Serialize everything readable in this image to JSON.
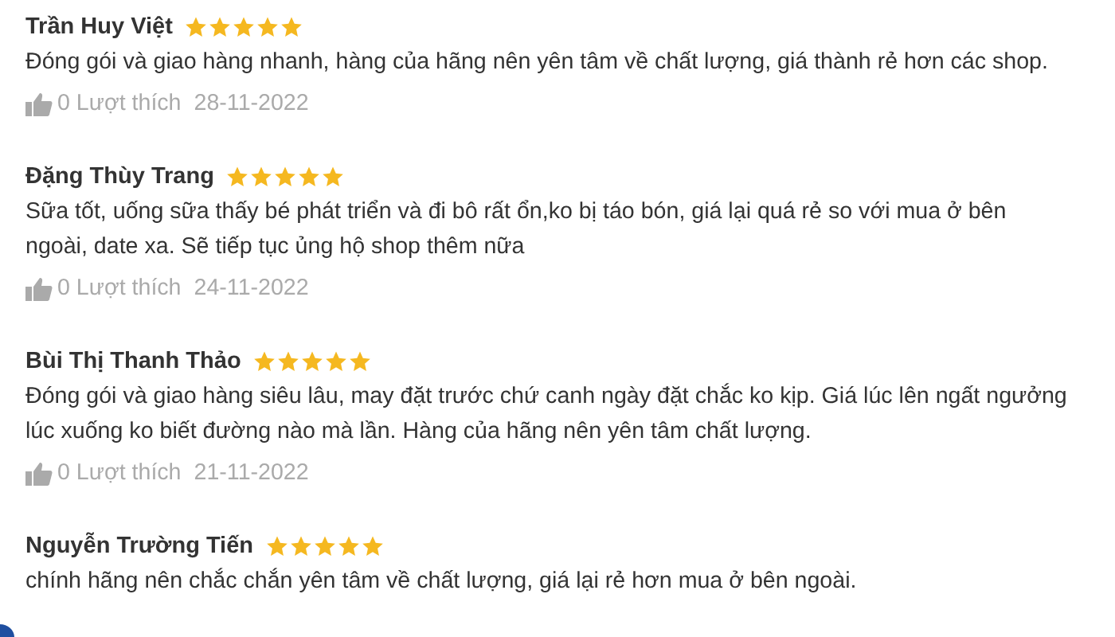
{
  "reviews": [
    {
      "name": "Trần Huy Việt",
      "stars": 5,
      "comment": "Đóng gói và giao hàng nhanh, hàng của hãng nên yên tâm về chất lượng, giá thành rẻ hơn các shop.",
      "likes": "0 Lượt thích",
      "date": "28-11-2022"
    },
    {
      "name": "Đặng Thùy Trang",
      "stars": 5,
      "comment": "Sữa tốt, uống sữa thấy bé phát triển và đi bô rất ổn,ko bị táo bón, giá lại quá rẻ so với mua ở bên ngoài, date xa. Sẽ tiếp tục ủng hộ shop thêm nữa",
      "likes": "0 Lượt thích",
      "date": "24-11-2022"
    },
    {
      "name": "Bùi Thị Thanh Thảo",
      "stars": 5,
      "comment": "Đóng gói và giao hàng siêu lâu, may đặt trước chứ canh ngày đặt chắc ko kịp. Giá lúc lên ngất ngưởng lúc xuống ko biết đường nào mà lần. Hàng của hãng nên yên tâm chất lượng.",
      "likes": "0 Lượt thích",
      "date": "21-11-2022"
    },
    {
      "name": "Nguyễn Trường Tiến",
      "stars": 5,
      "comment": "chính hãng nên chắc chắn yên tâm về chất lượng, giá lại rẻ hơn mua ở bên ngoài."
    }
  ]
}
